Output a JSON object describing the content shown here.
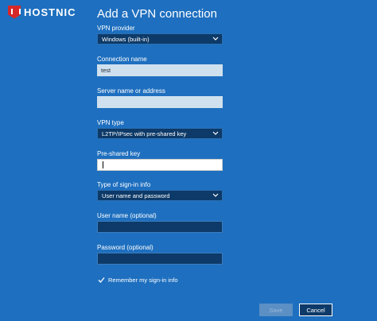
{
  "brand": {
    "name": "HOSTNIC",
    "accent": "#d62828"
  },
  "window": {
    "title": "Add a VPN connection"
  },
  "vpn_provider": {
    "label": "VPN provider",
    "value": "Windows (built-in)"
  },
  "connection_name": {
    "label": "Connection name",
    "value": "test"
  },
  "server": {
    "label": "Server name or address",
    "value": ""
  },
  "vpn_type": {
    "label": "VPN type",
    "value": "L2TP/IPsec with pre-shared key"
  },
  "preshared_key": {
    "label": "Pre-shared key",
    "value": ""
  },
  "signin_type": {
    "label": "Type of sign-in info",
    "value": "User name and password"
  },
  "username": {
    "label": "User name (optional)",
    "value": ""
  },
  "password": {
    "label": "Password (optional)",
    "value": ""
  },
  "remember": {
    "label": "Remember my sign-in info",
    "checked": true
  },
  "buttons": {
    "save": "Save",
    "cancel": "Cancel"
  },
  "colors": {
    "background": "#1e6fbf",
    "field_dark": "#0d3a68",
    "field_light": "#cfe0ee"
  }
}
